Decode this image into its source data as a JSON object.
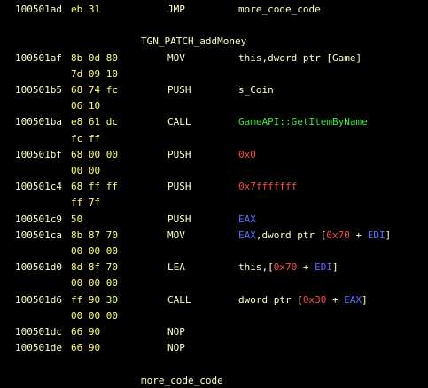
{
  "listing": {
    "rows": [
      {
        "type": "instr",
        "addr": "100501ad",
        "bytes": "eb 31",
        "mnem": "JMP",
        "ops": [
          {
            "t": "more_code_code",
            "c": "plain"
          }
        ]
      },
      {
        "type": "blank"
      },
      {
        "type": "label",
        "text": "TGN_PATCH_addMoney"
      },
      {
        "type": "instr",
        "addr": "100501af",
        "bytes": "8b 0d 80",
        "mnem": "MOV",
        "ops": [
          {
            "t": "this",
            "c": "plain"
          },
          {
            "t": ",dword ptr [Game]",
            "c": "plain"
          }
        ]
      },
      {
        "type": "cont",
        "bytes": "7d 09 10"
      },
      {
        "type": "instr",
        "addr": "100501b5",
        "bytes": "68 74 fc",
        "mnem": "PUSH",
        "ops": [
          {
            "t": "s_Coin",
            "c": "plain"
          }
        ]
      },
      {
        "type": "cont",
        "bytes": "06 10"
      },
      {
        "type": "instr",
        "addr": "100501ba",
        "bytes": "e8 61 dc",
        "mnem": "CALL",
        "ops": [
          {
            "t": "GameAPI::GetItemByName",
            "c": "green"
          }
        ]
      },
      {
        "type": "cont",
        "bytes": "fc ff"
      },
      {
        "type": "instr",
        "addr": "100501bf",
        "bytes": "68 00 00",
        "mnem": "PUSH",
        "ops": [
          {
            "t": "0x0",
            "c": "red"
          }
        ]
      },
      {
        "type": "cont",
        "bytes": "00 00"
      },
      {
        "type": "instr",
        "addr": "100501c4",
        "bytes": "68 ff ff",
        "mnem": "PUSH",
        "ops": [
          {
            "t": "0x7fffffff",
            "c": "red"
          }
        ]
      },
      {
        "type": "cont",
        "bytes": "ff 7f"
      },
      {
        "type": "instr",
        "addr": "100501c9",
        "bytes": "50",
        "mnem": "PUSH",
        "ops": [
          {
            "t": "EAX",
            "c": "blue"
          }
        ]
      },
      {
        "type": "instr",
        "addr": "100501ca",
        "bytes": "8b 87 70",
        "mnem": "MOV",
        "ops": [
          {
            "t": "EAX",
            "c": "blue"
          },
          {
            "t": ",dword ptr [",
            "c": "plain"
          },
          {
            "t": "0x70",
            "c": "red"
          },
          {
            "t": " + ",
            "c": "plain"
          },
          {
            "t": "EDI",
            "c": "blue"
          },
          {
            "t": "]",
            "c": "plain"
          }
        ]
      },
      {
        "type": "cont",
        "bytes": "00 00 00"
      },
      {
        "type": "instr",
        "addr": "100501d0",
        "bytes": "8d 8f 70",
        "mnem": "LEA",
        "ops": [
          {
            "t": "this",
            "c": "plain"
          },
          {
            "t": ",[",
            "c": "plain"
          },
          {
            "t": "0x70",
            "c": "red"
          },
          {
            "t": " + ",
            "c": "plain"
          },
          {
            "t": "EDI",
            "c": "blue"
          },
          {
            "t": "]",
            "c": "plain"
          }
        ]
      },
      {
        "type": "cont",
        "bytes": "00 00 00"
      },
      {
        "type": "instr",
        "addr": "100501d6",
        "bytes": "ff 90 30",
        "mnem": "CALL",
        "ops": [
          {
            "t": "dword ptr [",
            "c": "plain"
          },
          {
            "t": "0x30",
            "c": "red"
          },
          {
            "t": " + ",
            "c": "plain"
          },
          {
            "t": "EAX",
            "c": "blue"
          },
          {
            "t": "]",
            "c": "plain"
          }
        ]
      },
      {
        "type": "cont",
        "bytes": "00 00 00"
      },
      {
        "type": "instr",
        "addr": "100501dc",
        "bytes": "66 90",
        "mnem": "NOP",
        "ops": []
      },
      {
        "type": "instr",
        "addr": "100501de",
        "bytes": "66 90",
        "mnem": "NOP",
        "ops": []
      },
      {
        "type": "blank"
      },
      {
        "type": "label",
        "text": "more_code_code"
      }
    ]
  },
  "colors": {
    "background": "#000000",
    "default_text": "#ffffc8",
    "bytes": "#ffff7a",
    "function": "#3ce83c",
    "constant": "#ff4a4a",
    "register": "#5a6eff"
  }
}
